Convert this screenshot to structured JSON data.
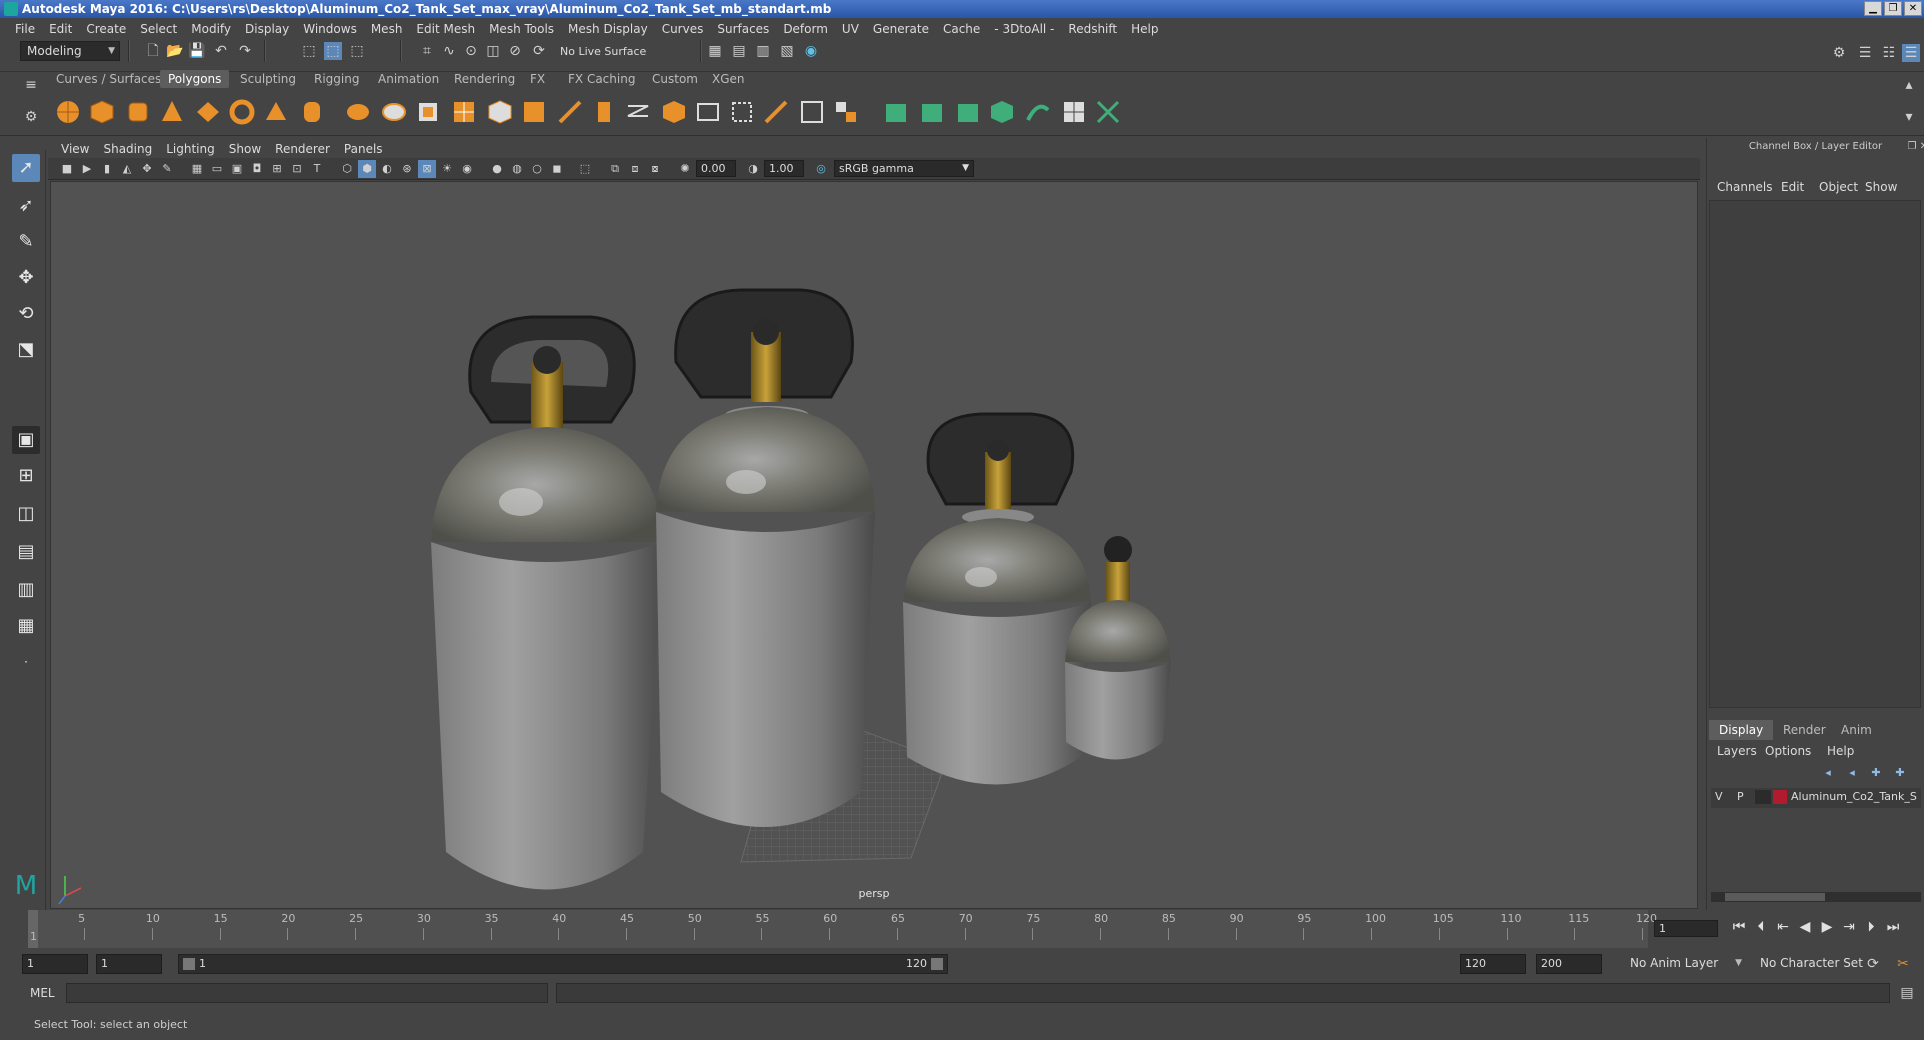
{
  "window": {
    "title": "Autodesk Maya 2016: C:\\Users\\rs\\Desktop\\Aluminum_Co2_Tank_Set_max_vray\\Aluminum_Co2_Tank_Set_mb_standart.mb",
    "buttons": [
      "▁",
      "❐",
      "✕"
    ]
  },
  "menubar": [
    "File",
    "Edit",
    "Create",
    "Select",
    "Modify",
    "Display",
    "Windows",
    "Mesh",
    "Edit Mesh",
    "Mesh Tools",
    "Mesh Display",
    "Curves",
    "Surfaces",
    "Deform",
    "UV",
    "Generate",
    "Cache",
    "- 3DtoAll -",
    "Redshift",
    "Help"
  ],
  "statusline": {
    "mode_dropdown": "Modeling",
    "live_surface": "No Live Surface"
  },
  "shelf": {
    "tabs": [
      "Curves / Surfaces",
      "Polygons",
      "Sculpting",
      "Rigging",
      "Animation",
      "Rendering",
      "FX",
      "FX Caching",
      "Custom",
      "XGen"
    ],
    "active_tab": "Polygons"
  },
  "panel": {
    "menu": [
      "View",
      "Shading",
      "Lighting",
      "Show",
      "Renderer",
      "Panels"
    ],
    "exposure": "0.00",
    "gamma": "1.00",
    "color_space": "sRGB gamma",
    "camera_label": "persp"
  },
  "channelbox": {
    "title": "Channel Box / Layer Editor",
    "menu": [
      "Channels",
      "Edit",
      "Object",
      "Show"
    ],
    "layer_tabs": [
      "Display",
      "Render",
      "Anim"
    ],
    "layer_menu": [
      "Layers",
      "Options",
      "Help"
    ],
    "layer": {
      "v": "V",
      "p": "P",
      "name": "Aluminum_Co2_Tank_S",
      "color": "#b01c2e"
    }
  },
  "timeline": {
    "ticks": [
      "5",
      "10",
      "15",
      "20",
      "25",
      "30",
      "35",
      "40",
      "45",
      "50",
      "55",
      "60",
      "65",
      "70",
      "75",
      "80",
      "85",
      "90",
      "95",
      "100",
      "105",
      "110",
      "115",
      "120"
    ],
    "start_tick": "1",
    "current_frame": "1"
  },
  "range": {
    "start": "1",
    "playback_start": "1",
    "slider_start": "1",
    "slider_end": "120",
    "playback_end": "120",
    "end": "200",
    "anim_layer": "No Anim Layer",
    "character_set": "No Character Set"
  },
  "cmdline": {
    "label": "MEL"
  },
  "helpline": {
    "text": "Select Tool: select an object"
  }
}
